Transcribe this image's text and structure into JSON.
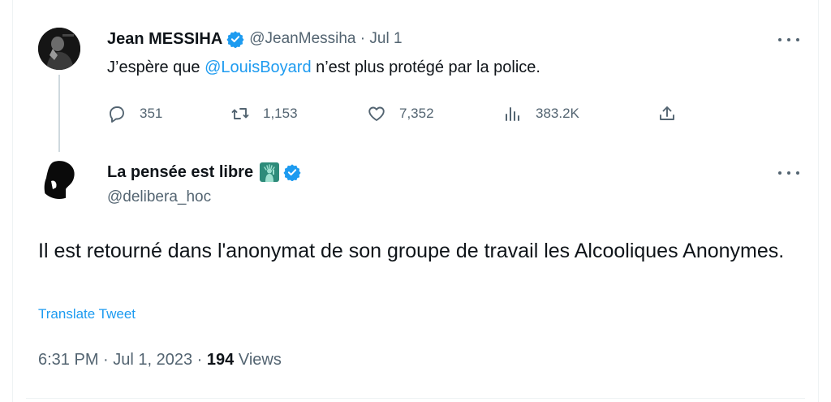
{
  "parent": {
    "name": "Jean MESSIHA",
    "handle": "@JeanMessiha",
    "separator": " · ",
    "date": "Jul 1",
    "text_before": "J’espère que ",
    "mention": "@LouisBoyard",
    "text_after": " n’est plus protégé par la police.",
    "stats": {
      "replies": "351",
      "retweets": "1,153",
      "likes": "7,352",
      "views": "383.2K"
    }
  },
  "reply": {
    "name": "La pensée est libre",
    "handle": "@delibera_hoc",
    "text": "Il est retourné dans l'anonymat de son groupe de travail les Alcooliques Anonymes.",
    "translate_label": "Translate Tweet",
    "time": "6:31 PM",
    "date": "Jul 1, 2023",
    "views_count": "194",
    "views_label": "Views",
    "sep": " · "
  },
  "colors": {
    "accent": "#1d9bf0",
    "secondary_text": "#536471",
    "primary_text": "#0f1419"
  },
  "icons": {
    "verified": "verified-badge-icon",
    "more": "more-dots-icon",
    "reply": "reply-bubble-icon",
    "retweet": "retweet-icon",
    "like": "heart-icon",
    "views": "views-bar-chart-icon",
    "share": "share-upload-icon",
    "emoji": "statue-of-liberty-emoji"
  }
}
